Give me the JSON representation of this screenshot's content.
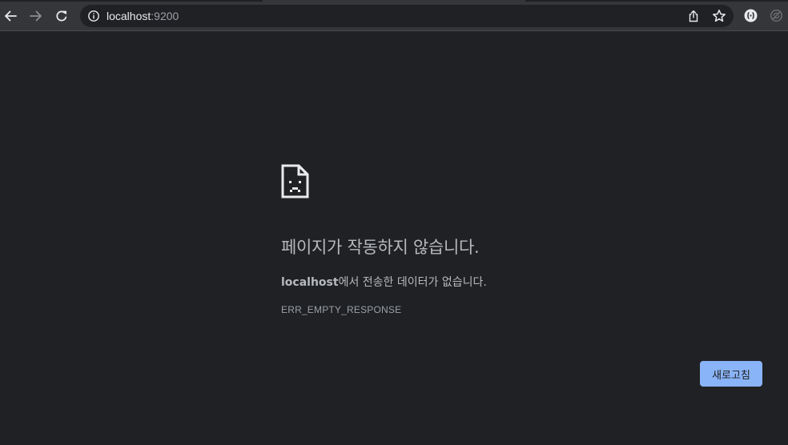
{
  "browser": {
    "url": {
      "host": "localhost",
      "port": ":9200"
    },
    "icons": {
      "back": "back-arrow-icon",
      "forward": "forward-arrow-icon",
      "reload": "reload-icon",
      "site_info": "info-icon",
      "share": "share-icon",
      "bookmark": "star-icon",
      "extension": "extension-icon",
      "sync": "sync-icon"
    }
  },
  "error_page": {
    "icon": "sad-page-icon",
    "title": "페이지가 작동하지 않습니다.",
    "message_host": "localhost",
    "message_rest": "에서 전송한 데이터가 없습니다.",
    "error_code": "ERR_EMPTY_RESPONSE",
    "reload_button": "새로고침"
  },
  "colors": {
    "background": "#202124",
    "toolbar": "#35363a",
    "button": "#8ab4f8"
  }
}
